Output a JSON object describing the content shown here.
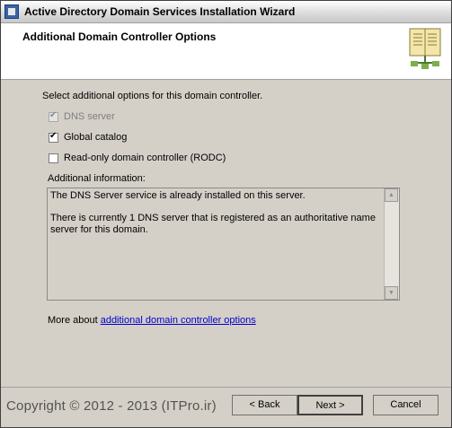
{
  "window": {
    "title": "Active Directory Domain Services Installation Wizard"
  },
  "header": {
    "title": "Additional Domain Controller Options",
    "icon": "directory-book-icon"
  },
  "options": {
    "prompt": "Select additional options for this domain controller.",
    "items": [
      {
        "label": "DNS server",
        "checked": true,
        "enabled": false
      },
      {
        "label": "Global catalog",
        "checked": true,
        "enabled": true
      },
      {
        "label": "Read-only domain controller (RODC)",
        "checked": false,
        "enabled": true
      }
    ]
  },
  "info": {
    "label": "Additional information:",
    "line1": "The DNS Server service is already installed on this server.",
    "line2": "There is currently 1 DNS server that is registered as an authoritative name server for this domain."
  },
  "more": {
    "prefix": "More about ",
    "link": "additional domain controller options"
  },
  "buttons": {
    "back": "< Back",
    "next": "Next >",
    "cancel": "Cancel"
  },
  "watermark": "Copyright © 2012 - 2013 (ITPro.ir)"
}
